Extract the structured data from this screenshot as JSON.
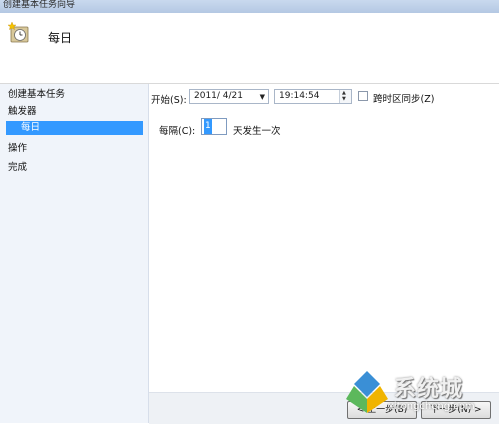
{
  "window": {
    "title": "创建基本任务向导"
  },
  "header": {
    "page_title": "每日",
    "icon": "clock-calendar-icon"
  },
  "sidebar": {
    "items": [
      {
        "label": "创建基本任务"
      },
      {
        "label": "触发器"
      },
      {
        "label": "每日",
        "active": true
      },
      {
        "label": "操作"
      },
      {
        "label": "完成"
      }
    ]
  },
  "form": {
    "start_label": "开始(S):",
    "start_date": "2011/ 4/21",
    "start_time": "19:14:54",
    "sync_label": "跨时区同步(Z)",
    "sync_checked": false,
    "recur_label": "每隔(C):",
    "recur_value": "1",
    "recur_suffix": "天发生一次"
  },
  "footer": {
    "back_label": "< 上一步(B)",
    "next_label": "下一步(N) >"
  },
  "watermark": {
    "text": "系统城",
    "url": "xitongcheng.com"
  },
  "colors": {
    "accent": "#3399ff",
    "sidebar_bg": "#f0f4fa"
  }
}
